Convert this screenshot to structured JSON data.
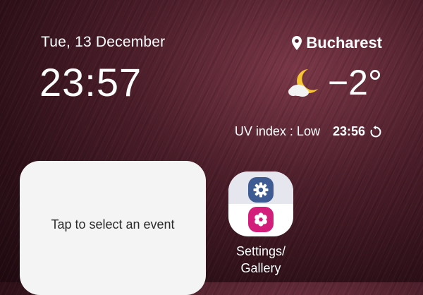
{
  "lockscreen": {
    "date": "Tue, 13 December",
    "time": "23:57"
  },
  "weather": {
    "location": "Bucharest",
    "temperature": "−2°",
    "uv": "UV index : Low",
    "updated_time": "23:56",
    "icon": "moon-cloud-icon"
  },
  "event_widget": {
    "text": "Tap to select an event"
  },
  "folder": {
    "label_line1": "Settings/",
    "label_line2": "Gallery",
    "apps": [
      "settings",
      "gallery"
    ]
  },
  "colors": {
    "settings_app": "#3f5b93",
    "gallery_app": "#d31d7a",
    "moon": "#f7c530"
  }
}
